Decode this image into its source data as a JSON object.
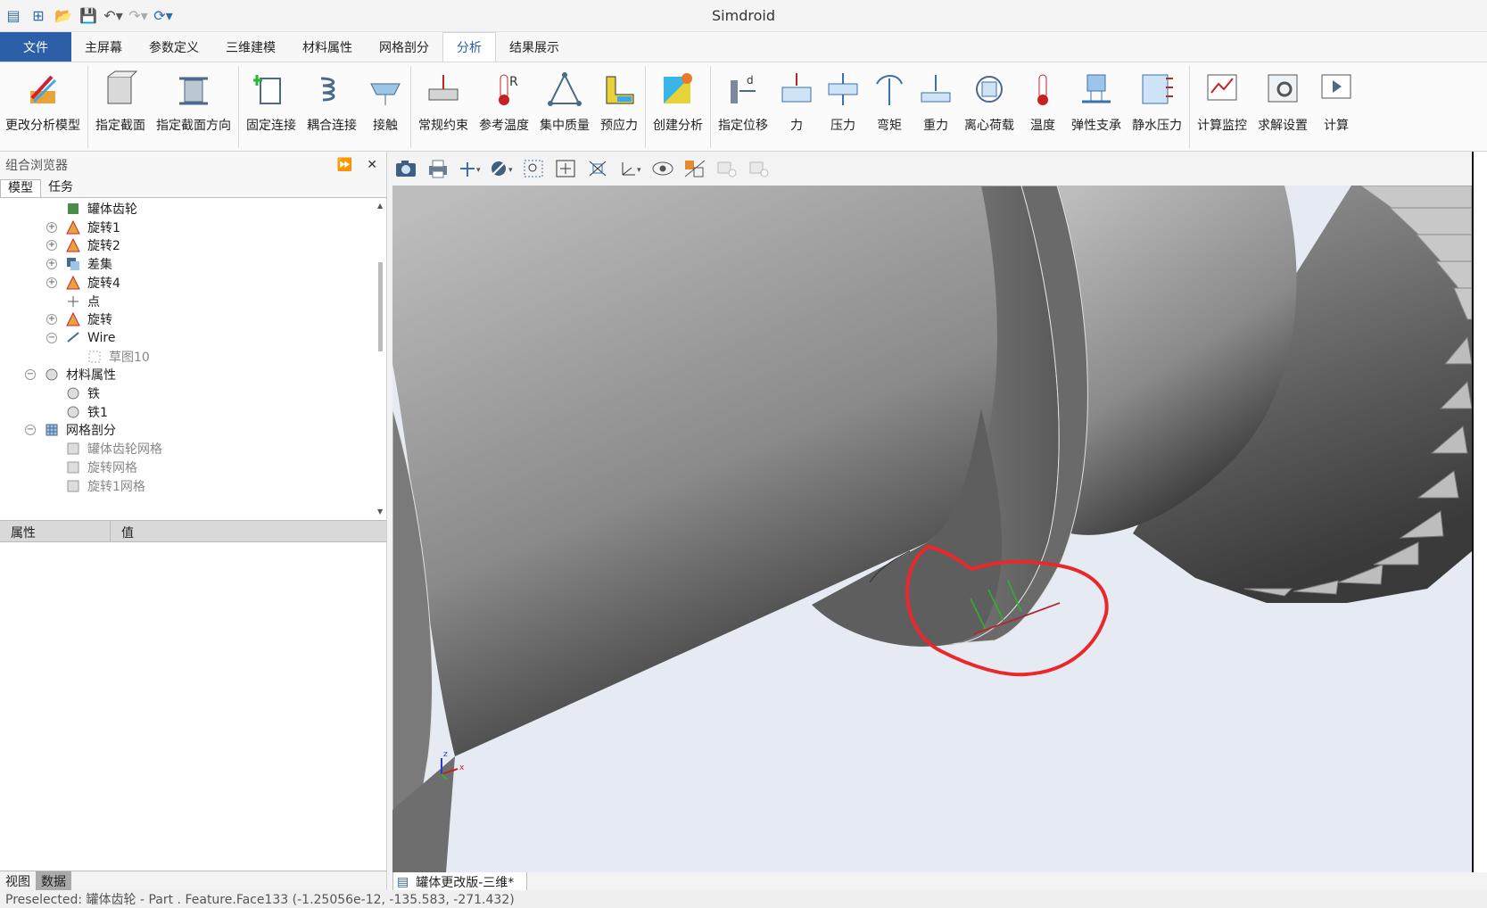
{
  "window": {
    "title": "Simdroid"
  },
  "tabs": [
    "文件",
    "主屏幕",
    "参数定义",
    "三维建模",
    "材料属性",
    "网格剖分",
    "分析",
    "结果展示"
  ],
  "ribbon": {
    "groups": [
      [
        "更改分析模型"
      ],
      [
        "指定截面",
        "指定截面方向"
      ],
      [
        "固定连接",
        "耦合连接",
        "接触"
      ],
      [
        "常规约束",
        "参考温度",
        "集中质量",
        "预应力"
      ],
      [
        "创建分析"
      ],
      [
        "指定位移",
        "力",
        "压力",
        "弯矩",
        "重力",
        "离心荷载",
        "温度",
        "弹性支承",
        "静水压力"
      ],
      [
        "计算监控",
        "求解设置",
        "计算"
      ]
    ]
  },
  "panel": {
    "title": "组合浏览器",
    "tab_model": "模型",
    "tab_task": "任务"
  },
  "tree": [
    {
      "label": "罐体齿轮",
      "level": 2,
      "exp": "",
      "icon": "part"
    },
    {
      "label": "旋转1",
      "level": 2,
      "exp": "+",
      "icon": "rev"
    },
    {
      "label": "旋转2",
      "level": 2,
      "exp": "+",
      "icon": "rev"
    },
    {
      "label": "差集",
      "level": 2,
      "exp": "+",
      "icon": "cut"
    },
    {
      "label": "旋转4",
      "level": 2,
      "exp": "+",
      "icon": "rev"
    },
    {
      "label": "点",
      "level": 2,
      "exp": "",
      "icon": "pt"
    },
    {
      "label": "旋转",
      "level": 2,
      "exp": "+",
      "icon": "rev"
    },
    {
      "label": "Wire",
      "level": 2,
      "exp": "−",
      "icon": "wire"
    },
    {
      "label": "草图10",
      "level": 3,
      "exp": "",
      "icon": "sk",
      "dim": true
    },
    {
      "label": "材料属性",
      "level": 1,
      "exp": "−",
      "icon": "mat"
    },
    {
      "label": "铁",
      "level": 2,
      "exp": "",
      "icon": "mat"
    },
    {
      "label": "铁1",
      "level": 2,
      "exp": "",
      "icon": "mat"
    },
    {
      "label": "网格剖分",
      "level": 1,
      "exp": "−",
      "icon": "mesh"
    },
    {
      "label": "罐体齿轮网格",
      "level": 2,
      "exp": "",
      "icon": "m",
      "dim": true
    },
    {
      "label": "旋转网格",
      "level": 2,
      "exp": "",
      "icon": "m",
      "dim": true
    },
    {
      "label": "旋转1网格",
      "level": 2,
      "exp": "",
      "icon": "m",
      "dim": true
    }
  ],
  "props": {
    "col_prop": "属性",
    "col_val": "值"
  },
  "bottom_tabs": [
    "视图",
    "数据"
  ],
  "doc_tab": "罐体更改版-三维*",
  "status": "Preselected: 罐体齿轮 -                    Part . Feature.Face133 (-1.25056e-12, -135.583, -271.432)",
  "colors": {
    "accent": "#2d5fa8",
    "annotation": "#e8282b"
  }
}
